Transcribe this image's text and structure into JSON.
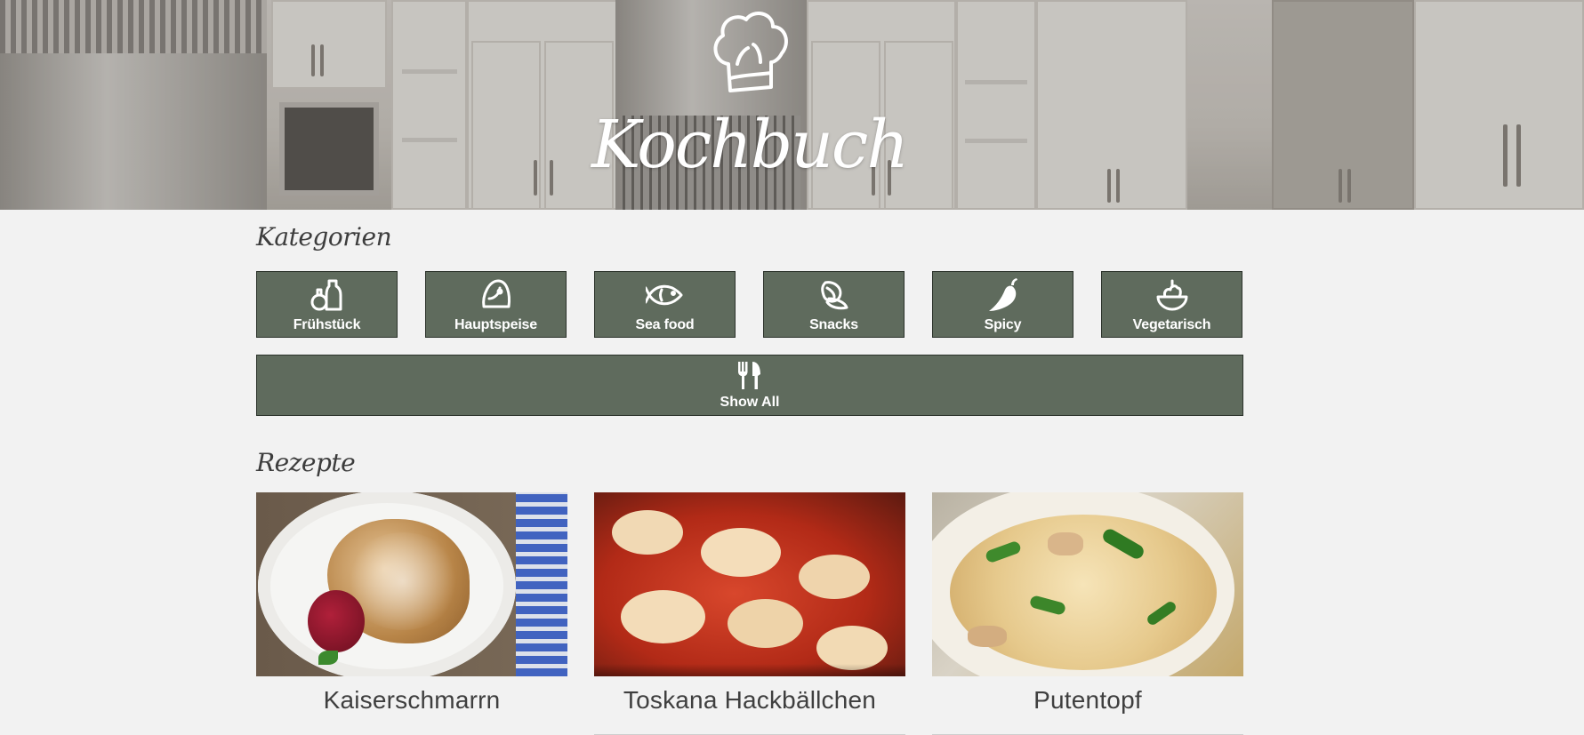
{
  "header": {
    "title": "Kochbuch",
    "logo_icon": "chef-hat-icon"
  },
  "categories": {
    "heading": "Kategorien",
    "items": [
      {
        "label": "Frühstück",
        "icon": "bottles-icon"
      },
      {
        "label": "Hauptspeise",
        "icon": "dumpling-icon"
      },
      {
        "label": "Sea food",
        "icon": "fish-icon"
      },
      {
        "label": "Snacks",
        "icon": "nachos-icon"
      },
      {
        "label": "Spicy",
        "icon": "chili-pepper-icon"
      },
      {
        "label": "Vegetarisch",
        "icon": "salad-bowl-icon"
      }
    ],
    "show_all": {
      "label": "Show All",
      "icon": "fork-knife-icon"
    }
  },
  "recipes": {
    "heading": "Rezepte",
    "items": [
      {
        "name": "Kaiserschmarrn"
      },
      {
        "name": "Toskana Hackbällchen"
      },
      {
        "name": "Putentopf"
      }
    ]
  },
  "colors": {
    "button_bg": "#5f6b5d",
    "button_border": "#2c332b",
    "page_bg": "#f2f2f2"
  }
}
